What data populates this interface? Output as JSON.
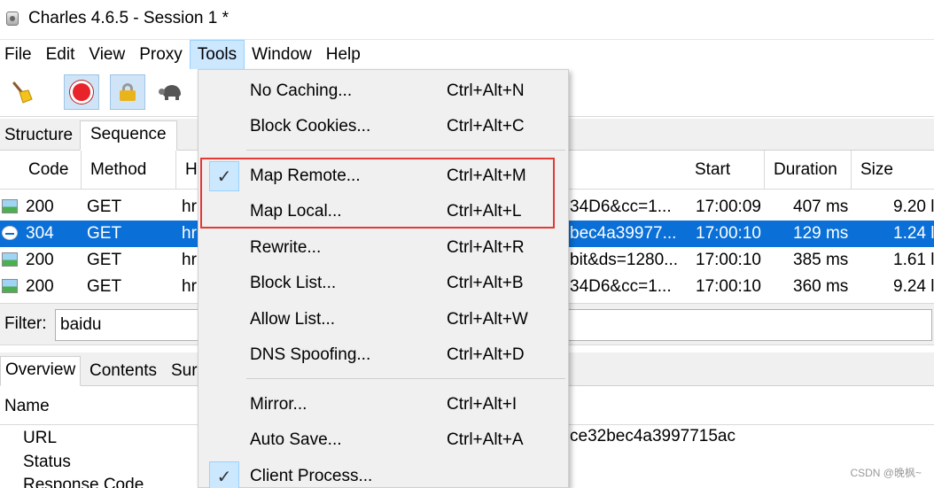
{
  "window": {
    "title": "Charles 4.6.5 - Session 1 *"
  },
  "menubar": {
    "items": [
      "File",
      "Edit",
      "View",
      "Proxy",
      "Tools",
      "Window",
      "Help"
    ],
    "active": "Tools"
  },
  "toolbar": {
    "buttons": [
      "broom-icon",
      "record-icon",
      "ssl-lock-icon",
      "throttle-turtle-icon"
    ]
  },
  "tabs_top": {
    "structure": "Structure",
    "sequence": "Sequence"
  },
  "table": {
    "headers": {
      "code": "Code",
      "method": "Method",
      "host": "H",
      "start": "Start",
      "duration": "Duration",
      "size": "Size"
    },
    "rows": [
      {
        "code": "200",
        "method": "GET",
        "host": "hr",
        "path": "34D6&cc=1...",
        "start": "17:00:09",
        "duration": "407 ms",
        "size": "9.20 l"
      },
      {
        "code": "304",
        "method": "GET",
        "host": "hr",
        "path": "bec4a39977...",
        "start": "17:00:10",
        "duration": "129 ms",
        "size": "1.24 l"
      },
      {
        "code": "200",
        "method": "GET",
        "host": "hr",
        "path": "bit&ds=1280...",
        "start": "17:00:10",
        "duration": "385 ms",
        "size": "1.61 l"
      },
      {
        "code": "200",
        "method": "GET",
        "host": "hr",
        "path": "34D6&cc=1...",
        "start": "17:00:10",
        "duration": "360 ms",
        "size": "9.24 l"
      }
    ]
  },
  "filter": {
    "label": "Filter:",
    "value": "baidu"
  },
  "tabs_bottom": {
    "overview": "Overview",
    "contents": "Contents",
    "summary": "Sur"
  },
  "detail": {
    "header": "Name",
    "rows": [
      "URL",
      "Status",
      "Response Code"
    ],
    "url_value": "ce32bec4a3997715ac"
  },
  "tools_menu": {
    "items": [
      {
        "label": "No Caching...",
        "shortcut": "Ctrl+Alt+N",
        "checked": false
      },
      {
        "label": "Block Cookies...",
        "shortcut": "Ctrl+Alt+C",
        "checked": false
      },
      {
        "label": "Map Remote...",
        "shortcut": "Ctrl+Alt+M",
        "checked": true
      },
      {
        "label": "Map Local...",
        "shortcut": "Ctrl+Alt+L",
        "checked": false
      },
      {
        "label": "Rewrite...",
        "shortcut": "Ctrl+Alt+R",
        "checked": false
      },
      {
        "label": "Block List...",
        "shortcut": "Ctrl+Alt+B",
        "checked": false
      },
      {
        "label": "Allow List...",
        "shortcut": "Ctrl+Alt+W",
        "checked": false
      },
      {
        "label": "DNS Spoofing...",
        "shortcut": "Ctrl+Alt+D",
        "checked": false
      },
      {
        "label": "Mirror...",
        "shortcut": "Ctrl+Alt+I",
        "checked": false
      },
      {
        "label": "Auto Save...",
        "shortcut": "Ctrl+Alt+A",
        "checked": false
      },
      {
        "label": "Client Process...",
        "shortcut": "",
        "checked": true
      }
    ]
  },
  "watermark": "CSDN @晚枫~",
  "colors": {
    "selection": "#0a6fd6",
    "highlight_box": "#e53935",
    "menu_bg": "#f0f0f0",
    "check_bg": "#cce8ff"
  }
}
